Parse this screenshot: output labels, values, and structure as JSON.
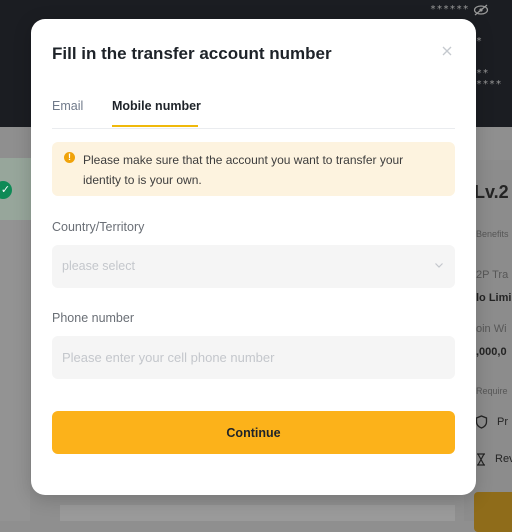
{
  "background": {
    "masked_values": [
      "****** ",
      "*",
      "** ****"
    ],
    "level_badge": "Lv.2",
    "benefits_label": "Benefits",
    "p2p_label": "2P Tra",
    "no_limit_label": "lo Limi",
    "coin_label": "oin Wi",
    "amount_label": ",000,0",
    "requirements_label": "Require",
    "item_1": "Pr",
    "item_2": "Rev"
  },
  "modal": {
    "title": "Fill in the transfer account number",
    "close_icon": "close-icon",
    "tabs": [
      {
        "label": "Email",
        "active": false
      },
      {
        "label": "Mobile number",
        "active": true
      }
    ],
    "notice": "Please make sure that the account you want to transfer your identity to is your own.",
    "country": {
      "label": "Country/Territory",
      "placeholder": "please select"
    },
    "phone": {
      "label": "Phone number",
      "placeholder": "Please enter your cell phone number",
      "value": ""
    },
    "continue_label": "Continue"
  },
  "colors": {
    "accent": "#fcb21a",
    "tab_underline": "#f0b90b",
    "notice_bg": "#fdf3df",
    "notice_icon": "#f0a30a",
    "field_bg": "#f5f5f5"
  }
}
